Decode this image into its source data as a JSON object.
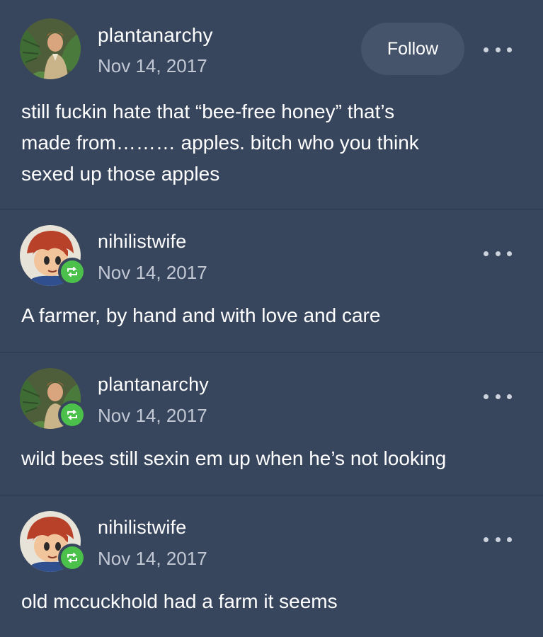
{
  "posts": [
    {
      "username": "plantanarchy",
      "date": "Nov 14, 2017",
      "follow_label": "Follow",
      "lines": [
        "still fuckin hate that “bee-free honey” that’s",
        "made from……… apples. bitch who you think",
        "sexed up those apples"
      ],
      "reblog": false,
      "avatar": "monstera-avatar"
    },
    {
      "username": "nihilistwife",
      "date": "Nov 14, 2017",
      "lines": [
        "A farmer, by hand and with love and care"
      ],
      "reblog": true,
      "avatar": "cartoon-boy-avatar"
    },
    {
      "username": "plantanarchy",
      "date": "Nov 14, 2017",
      "lines": [
        "wild bees still sexin em up when he’s not looking"
      ],
      "reblog": true,
      "avatar": "monstera-avatar"
    },
    {
      "username": "nihilistwife",
      "date": "Nov 14, 2017",
      "lines": [
        "old mccuckhold had a farm it seems"
      ],
      "reblog": true,
      "avatar": "cartoon-boy-avatar"
    }
  ],
  "colors": {
    "background": "#37455d",
    "follow_button": "#46546b",
    "reblog_green": "#4bc14b",
    "secondary_text": "#c1c8d4"
  },
  "icons": {
    "more": "more-options-icon",
    "reblog": "reblog-icon"
  }
}
